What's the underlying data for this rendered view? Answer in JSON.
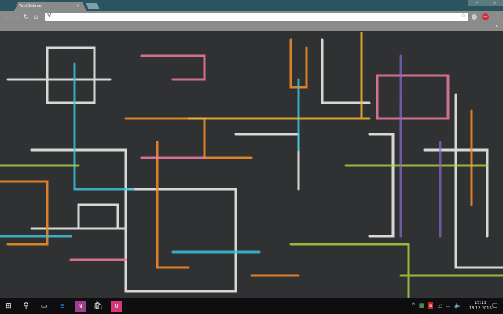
{
  "browser": {
    "tab_title": "Yeni Sekme",
    "tab_close": "×",
    "window_controls": {
      "minimize": "–",
      "restore": "❐",
      "close": "✕"
    },
    "address_placeholder": "",
    "bookmarks_more": "»",
    "extension_badge": "ABP"
  },
  "wallpaper": {
    "description_icons": "chalkboard-doodles"
  },
  "taskbar": {
    "time": "15:13",
    "date": "18.12.2016"
  },
  "colors": {
    "titlebar": "#2a5560",
    "toolbar": "#8b8b8b",
    "taskbar": "#0e0e10"
  }
}
